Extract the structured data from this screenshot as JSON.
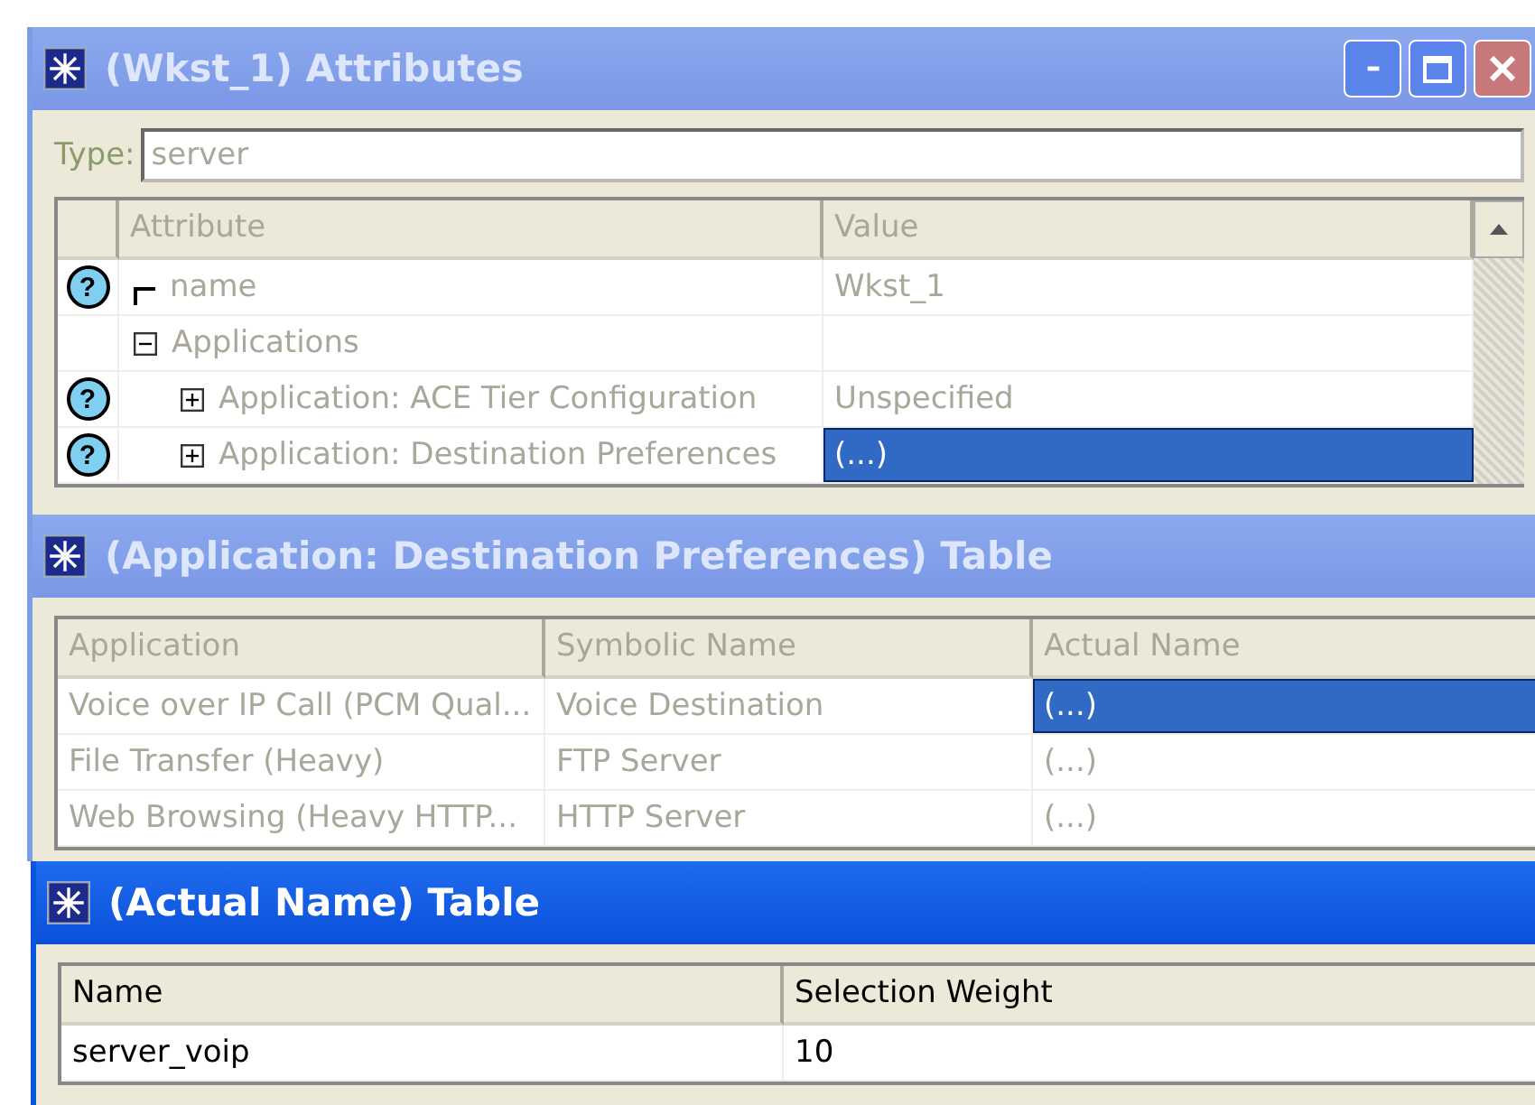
{
  "windows": [
    {
      "title": "(Wkst_1) Attributes",
      "active": false,
      "controls": true,
      "type_field": {
        "label": "Type:",
        "value": "server"
      },
      "attribute_table": {
        "columns": [
          "Attribute",
          "Value"
        ],
        "rows": [
          {
            "name": "name",
            "value": "Wkst_1",
            "help": "?",
            "selected": false
          },
          {
            "name": "Applications",
            "expanded": true,
            "children": [
              {
                "name": "Application: ACE Tier Configuration",
                "value": "Unspecified",
                "help": "?",
                "expanded": false,
                "selected": false
              },
              {
                "name": "Application: Destination Preferences",
                "value": "(...)",
                "help": "?",
                "expanded": false,
                "selected": true
              }
            ]
          }
        ]
      }
    },
    {
      "title": "(Application: Destination Preferences) Table",
      "active": false,
      "controls": false,
      "table": {
        "columns": [
          "Application",
          "Symbolic Name",
          "Actual Name"
        ],
        "rows": [
          {
            "cells": [
              "Voice over IP Call (PCM Qual...",
              "Voice Destination",
              "(...)"
            ],
            "selected": true
          },
          {
            "cells": [
              "File Transfer (Heavy)",
              "FTP Server",
              "(...)"
            ],
            "selected": false
          },
          {
            "cells": [
              "Web Browsing (Heavy HTTP...",
              "HTTP Server",
              "(...)"
            ],
            "selected": false
          }
        ]
      }
    },
    {
      "title": "(Actual Name) Table",
      "active": true,
      "controls": false,
      "table": {
        "columns": [
          "Name",
          "Selection Weight"
        ],
        "rows": [
          {
            "cells": [
              "server_voip",
              "10"
            ],
            "selected": false
          }
        ]
      }
    }
  ]
}
